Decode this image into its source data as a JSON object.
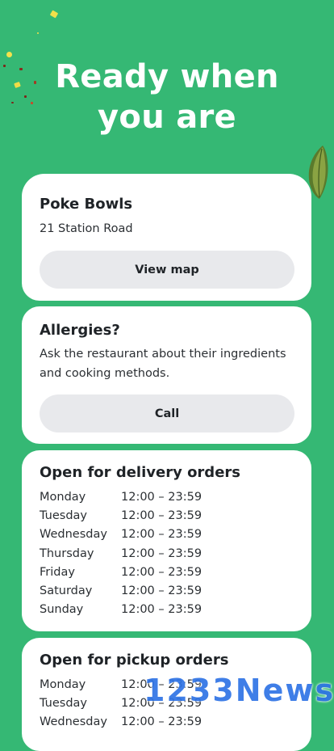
{
  "hero": {
    "line1": "Ready when",
    "line2": "you are"
  },
  "restaurant": {
    "name": "Poke Bowls",
    "address": "21 Station Road",
    "map_button": "View map"
  },
  "allergies": {
    "title": "Allergies?",
    "text": "Ask the restaurant about their ingredients and cooking methods.",
    "call_button": "Call"
  },
  "delivery": {
    "title": "Open for delivery orders",
    "hours": [
      {
        "day": "Monday",
        "time": "12:00 – 23:59"
      },
      {
        "day": "Tuesday",
        "time": "12:00 – 23:59"
      },
      {
        "day": "Wednesday",
        "time": "12:00 – 23:59"
      },
      {
        "day": "Thursday",
        "time": "12:00 – 23:59"
      },
      {
        "day": "Friday",
        "time": "12:00 – 23:59"
      },
      {
        "day": "Saturday",
        "time": "12:00 – 23:59"
      },
      {
        "day": "Sunday",
        "time": "12:00 – 23:59"
      }
    ]
  },
  "pickup": {
    "title": "Open for pickup orders",
    "hours": [
      {
        "day": "Monday",
        "time": "12:00 – 23:59"
      },
      {
        "day": "Tuesday",
        "time": "12:00 – 23:59"
      },
      {
        "day": "Wednesday",
        "time": "12:00 – 23:59"
      }
    ]
  },
  "watermark": "1233News",
  "colors": {
    "background": "#35b874",
    "card": "#ffffff",
    "button": "#e8e9ec",
    "text": "#1f2327",
    "watermark": "#2f74e6"
  },
  "icons": {
    "decoration": "leaf-icon"
  }
}
